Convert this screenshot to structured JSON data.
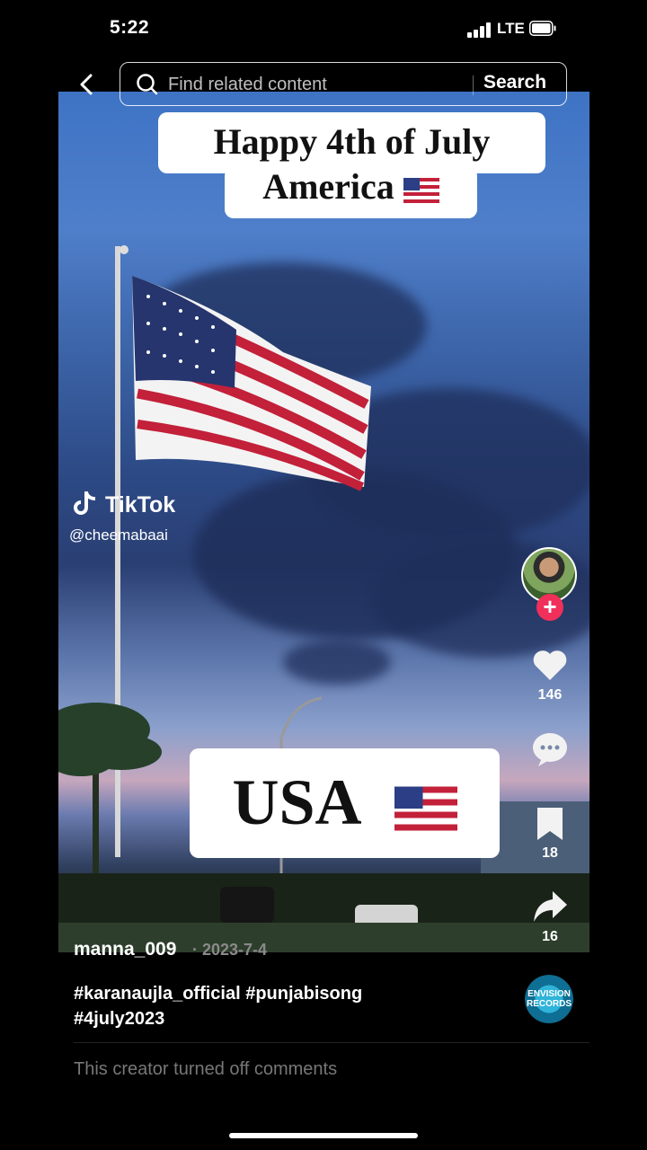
{
  "status_bar": {
    "time": "5:22",
    "network": "LTE"
  },
  "search": {
    "placeholder": "Find related content",
    "button_label": "Search"
  },
  "video": {
    "caption_top_line1": "Happy 4th of July",
    "caption_top_line2": "America",
    "caption_bottom": "USA",
    "watermark_brand": "TikTok",
    "watermark_handle": "@cheemabaai"
  },
  "actions": {
    "likes": "146",
    "bookmarks": "18",
    "shares": "16"
  },
  "post": {
    "author": "manna_009",
    "date": "· 2023-7-4",
    "description_line1": "#karanaujla_official #punjabisong",
    "description_line2": "#4july2023",
    "music_label": "ENVISION RECORDS",
    "comments_status": "This creator turned off comments"
  },
  "colors": {
    "follow": "#f0305a",
    "background": "#000000"
  }
}
